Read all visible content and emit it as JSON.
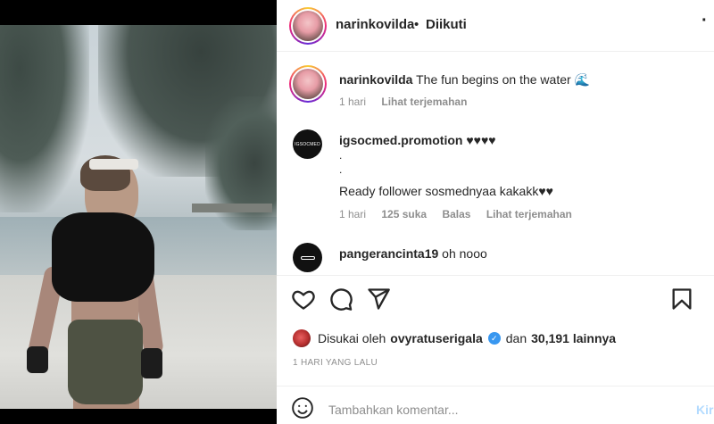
{
  "post": {
    "username": "narinkovilda",
    "separator": "•",
    "follow_status": "Diikuti",
    "more_label": "·",
    "caption": {
      "username": "narinkovilda",
      "text": "The fun begins on the water 🌊",
      "time": "1 hari",
      "translate": "Lihat terjemahan"
    },
    "comments": [
      {
        "username": "igsocmed.promotion",
        "avatar_text": "IGSOCMED",
        "text_line1": "♥♥♥♥",
        "text_line2": ".",
        "text_line3": ".",
        "text_line4": "Ready follower sosmednyaa kakakk♥♥",
        "time": "1 hari",
        "likes": "125 suka",
        "reply": "Balas",
        "translate": "Lihat terjemahan"
      },
      {
        "username": "pangerancinta19",
        "text": "oh nooo"
      }
    ],
    "liked_by": {
      "prefix": "Disukai oleh",
      "user": "ovyratuserigala",
      "verified_mark": "✓",
      "middle": "dan",
      "count": "30,191 lainnya"
    },
    "time_ago": "1 HARI YANG LALU",
    "add_comment": {
      "placeholder": "Tambahkan komentar...",
      "post_label": "Kir"
    }
  },
  "colors": {
    "link_blue": "#3897f0",
    "muted": "#8e8e8e",
    "post_disabled": "#b3dbff"
  },
  "icons": [
    "heart-icon",
    "comment-icon",
    "share-icon",
    "bookmark-icon",
    "emoji-icon",
    "verified-icon",
    "more-icon"
  ]
}
